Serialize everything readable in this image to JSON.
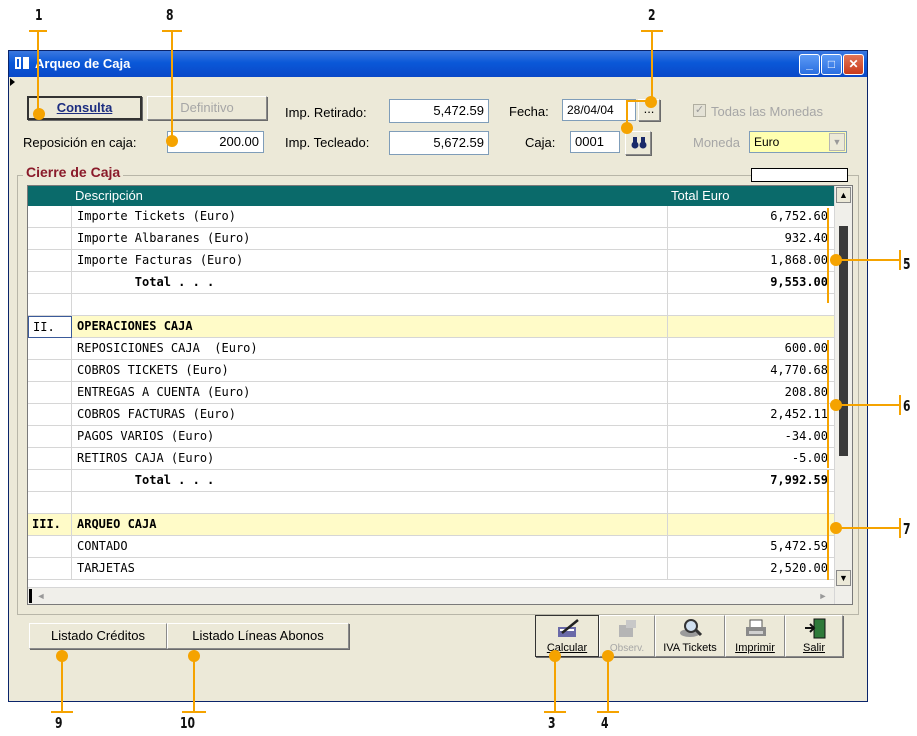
{
  "window": {
    "title": "Arqueo de Caja"
  },
  "toolbar": {
    "consulta": "Consulta",
    "definitivo": "Definitivo",
    "reposicion_label": "Reposición en caja:",
    "reposicion_value": "200.00",
    "imp_retirado_label": "Imp. Retirado:",
    "imp_retirado_value": "5,472.59",
    "imp_tecleado_label": "Imp. Tecleado:",
    "imp_tecleado_value": "5,672.59",
    "fecha_label": "Fecha:",
    "fecha_value": "28/04/04",
    "fecha_button": "...",
    "caja_label": "Caja:",
    "caja_value": "0001",
    "todas_label": "Todas las Monedas",
    "moneda_label": "Moneda",
    "moneda_value": "Euro"
  },
  "group": {
    "title": "Cierre de Caja"
  },
  "grid": {
    "columns": [
      "Descripción",
      "Total Euro"
    ],
    "rows": [
      {
        "code": "",
        "desc": "Importe Tickets (Euro)",
        "total": "6,752.60",
        "kind": "item"
      },
      {
        "code": "",
        "desc": "Importe Albaranes (Euro)",
        "total": "932.40",
        "kind": "item"
      },
      {
        "code": "",
        "desc": "Importe Facturas (Euro)",
        "total": "1,868.00",
        "kind": "item"
      },
      {
        "code": "",
        "desc": "        Total . . .",
        "total": "9,553.00",
        "kind": "total"
      },
      {
        "code": "",
        "desc": "",
        "total": "",
        "kind": "blank"
      },
      {
        "code": "II.",
        "desc": "OPERACIONES CAJA",
        "total": "",
        "kind": "section"
      },
      {
        "code": "",
        "desc": "REPOSICIONES CAJA  (Euro)",
        "total": "600.00",
        "kind": "item"
      },
      {
        "code": "",
        "desc": "COBROS TICKETS (Euro)",
        "total": "4,770.68",
        "kind": "item"
      },
      {
        "code": "",
        "desc": "ENTREGAS A CUENTA (Euro)",
        "total": "208.80",
        "kind": "item"
      },
      {
        "code": "",
        "desc": "COBROS FACTURAS (Euro)",
        "total": "2,452.11",
        "kind": "item"
      },
      {
        "code": "",
        "desc": "PAGOS VARIOS (Euro)",
        "total": "-34.00",
        "kind": "item"
      },
      {
        "code": "",
        "desc": "RETIROS CAJA (Euro)",
        "total": "-5.00",
        "kind": "item"
      },
      {
        "code": "",
        "desc": "        Total . . .",
        "total": "7,992.59",
        "kind": "total"
      },
      {
        "code": "",
        "desc": "",
        "total": "",
        "kind": "blank"
      },
      {
        "code": "III.",
        "desc": "ARQUEO CAJA",
        "total": "",
        "kind": "section"
      },
      {
        "code": "",
        "desc": "CONTADO",
        "total": "5,472.59",
        "kind": "item"
      },
      {
        "code": "",
        "desc": "TARJETAS",
        "total": "2,520.00",
        "kind": "item"
      }
    ]
  },
  "bottom": {
    "listado_creditos": "Listado Créditos",
    "listado_lineas": "Listado Líneas Abonos",
    "calcular": "Calcular",
    "observ": "Observ.",
    "iva_tickets": "IVA Tickets",
    "imprimir": "Imprimir",
    "salir": "Salir"
  },
  "callouts": [
    "1",
    "8",
    "2",
    "5",
    "6",
    "7",
    "9",
    "10",
    "3",
    "4"
  ],
  "colors": {
    "accent": "#f5a300",
    "header": "#0a6a6a",
    "section": "#fffbc8",
    "titlebar": "#0a58d8"
  }
}
